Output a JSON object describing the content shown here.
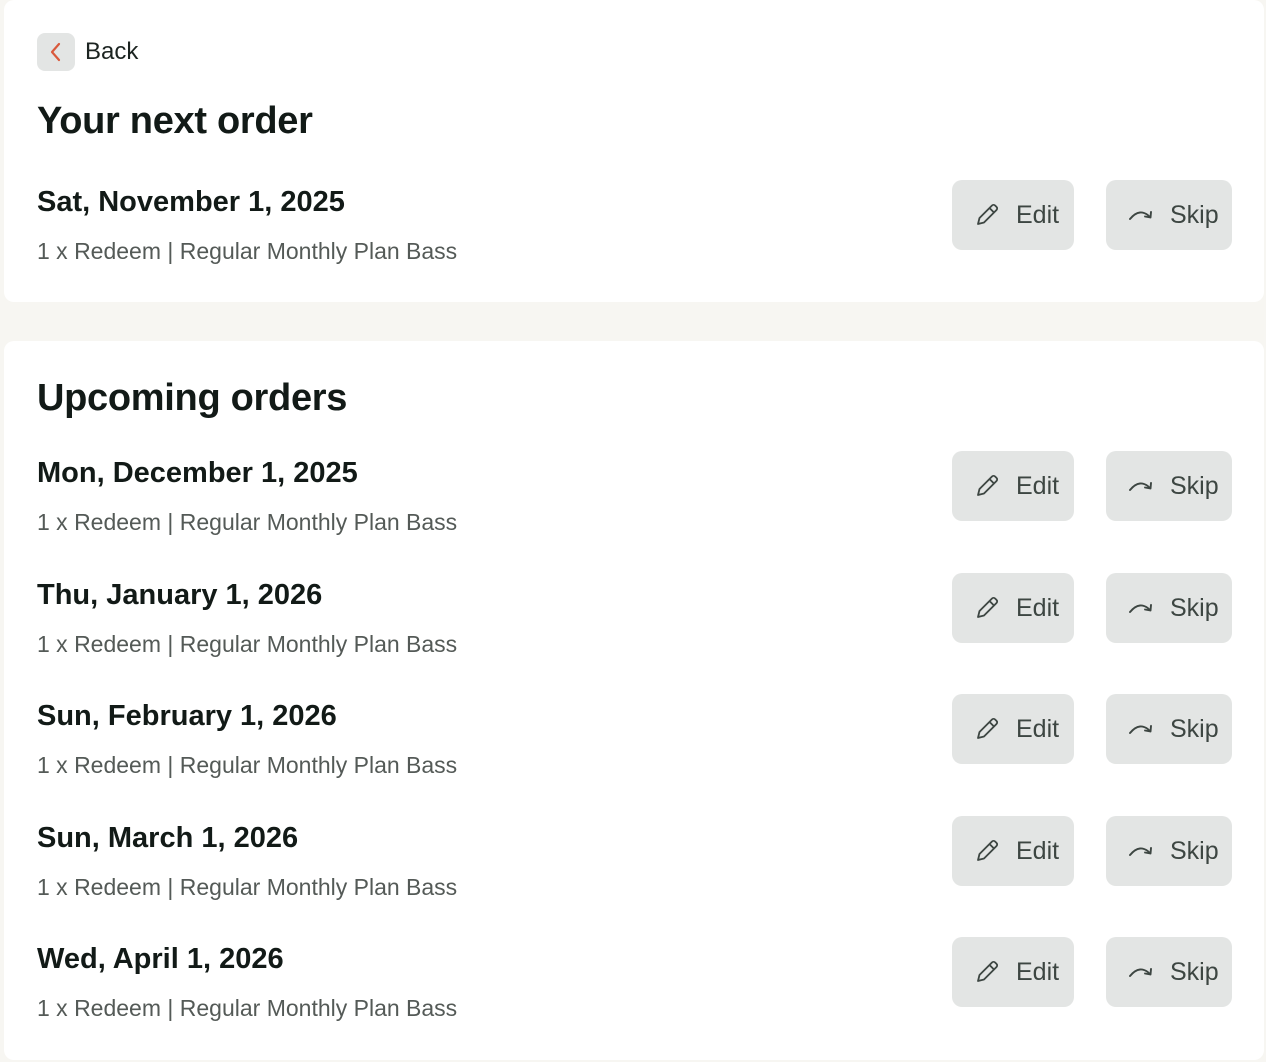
{
  "back": {
    "label": "Back"
  },
  "next_order": {
    "title": "Your next order",
    "order": {
      "date": "Sat, November 1, 2025",
      "description": "1 x Redeem | Regular Monthly Plan Bass",
      "edit_label": "Edit",
      "skip_label": "Skip"
    }
  },
  "upcoming": {
    "title": "Upcoming orders",
    "orders": [
      {
        "date": "Mon, December 1, 2025",
        "description": "1 x Redeem | Regular Monthly Plan Bass",
        "edit_label": "Edit",
        "skip_label": "Skip"
      },
      {
        "date": "Thu, January 1, 2026",
        "description": "1 x Redeem | Regular Monthly Plan Bass",
        "edit_label": "Edit",
        "skip_label": "Skip"
      },
      {
        "date": "Sun, February 1, 2026",
        "description": "1 x Redeem | Regular Monthly Plan Bass",
        "edit_label": "Edit",
        "skip_label": "Skip"
      },
      {
        "date": "Sun, March 1, 2026",
        "description": "1 x Redeem | Regular Monthly Plan Bass",
        "edit_label": "Edit",
        "skip_label": "Skip"
      },
      {
        "date": "Wed, April 1, 2026",
        "description": "1 x Redeem | Regular Monthly Plan Bass",
        "edit_label": "Edit",
        "skip_label": "Skip"
      }
    ]
  },
  "icons": {
    "back": "chevron-left-icon",
    "edit": "pencil-icon",
    "skip": "skip-arrow-icon"
  },
  "colors": {
    "accent": "#d9593c",
    "button_bg": "#e3e5e4",
    "page_bg": "#f7f6f2",
    "card_bg": "#ffffff"
  }
}
